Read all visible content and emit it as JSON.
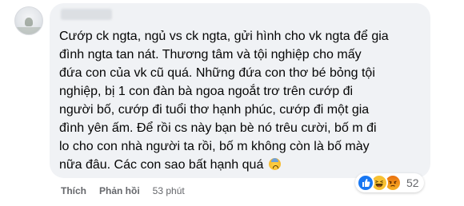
{
  "comment": {
    "text_lines": [
      "Cướp ck ngta, ngủ vs ck ngta, gửi hình cho vk ngta để gia",
      "đình ngta tan nát. Thương tâm và tội nghiệp cho mấy",
      "đứa con của vk cũ quá. Những đứa con thơ bé bỏng tội",
      "nghiệp, bị 1 con đàn bà ngoa ngoắt trơ trên cướp đi",
      "người bố, cướp đi tuổi thơ hạnh phúc, cướp đi một gia",
      "đình yên ấm. Để rồi cs này bạn bè nó trêu cười, bố m đi",
      "lo cho con nhà người ta rồi, bố m không còn là bố mày",
      "nữa đâu. Các con sao bất hạnh quá"
    ],
    "emoji": "anxious-face-emoji",
    "reactions": {
      "types": [
        "like-icon",
        "haha-icon",
        "angry-icon"
      ],
      "count": "52",
      "colors": {
        "like": "#1877f2",
        "haha": "#f7c133",
        "angry": "#e9710f"
      }
    },
    "actions": {
      "like_label": "Thích",
      "reply_label": "Phản hồi",
      "timestamp": "53 phút"
    }
  },
  "colors": {
    "bubble_bg": "#f0f2f5",
    "text": "#050505",
    "meta_text": "#65676b"
  }
}
